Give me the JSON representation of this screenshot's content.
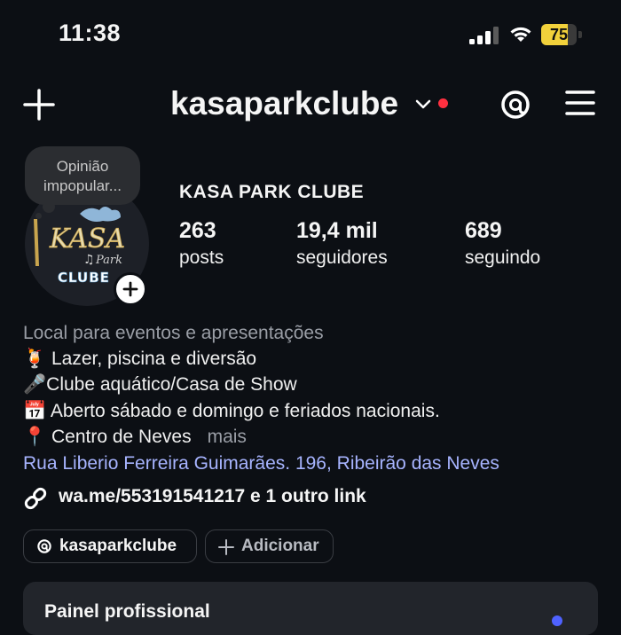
{
  "status_bar": {
    "time": "11:38",
    "battery_level": "75",
    "battery_percent": 75
  },
  "header": {
    "username": "kasaparkclube"
  },
  "avatar": {
    "note": [
      "Opinião",
      "impopular..."
    ],
    "logo_text_1": "KASA",
    "logo_text_2": "Park",
    "logo_text_3": "CLUBE"
  },
  "profile": {
    "display_name": "KASA PARK CLUBE",
    "stats": [
      {
        "value": "263",
        "label": "posts"
      },
      {
        "value": "19,4 mil",
        "label": "seguidores"
      },
      {
        "value": "689",
        "label": "seguindo"
      }
    ]
  },
  "bio": {
    "category": "Local para eventos e apresentações",
    "lines": [
      "🍹 Lazer, piscina e diversão",
      "🎤Clube aquático/Casa de Show",
      "📅 Aberto sábado e domingo e feriados nacionais.",
      "📍 Centro de Neves"
    ],
    "more": "mais",
    "address": "Rua Liberio Ferreira Guimarães. 196, Ribeirão das Neves",
    "link": "wa.me/553191541217 e 1 outro link"
  },
  "chips": {
    "threads_label": "kasaparkclube",
    "add_label": "Adicionar"
  },
  "professional_panel": {
    "title": "Painel profissional"
  },
  "colors": {
    "background": "#0c0f14",
    "link": "#a7b4ff",
    "notification_dot": "#ff3040",
    "battery": "#f2d13b"
  }
}
